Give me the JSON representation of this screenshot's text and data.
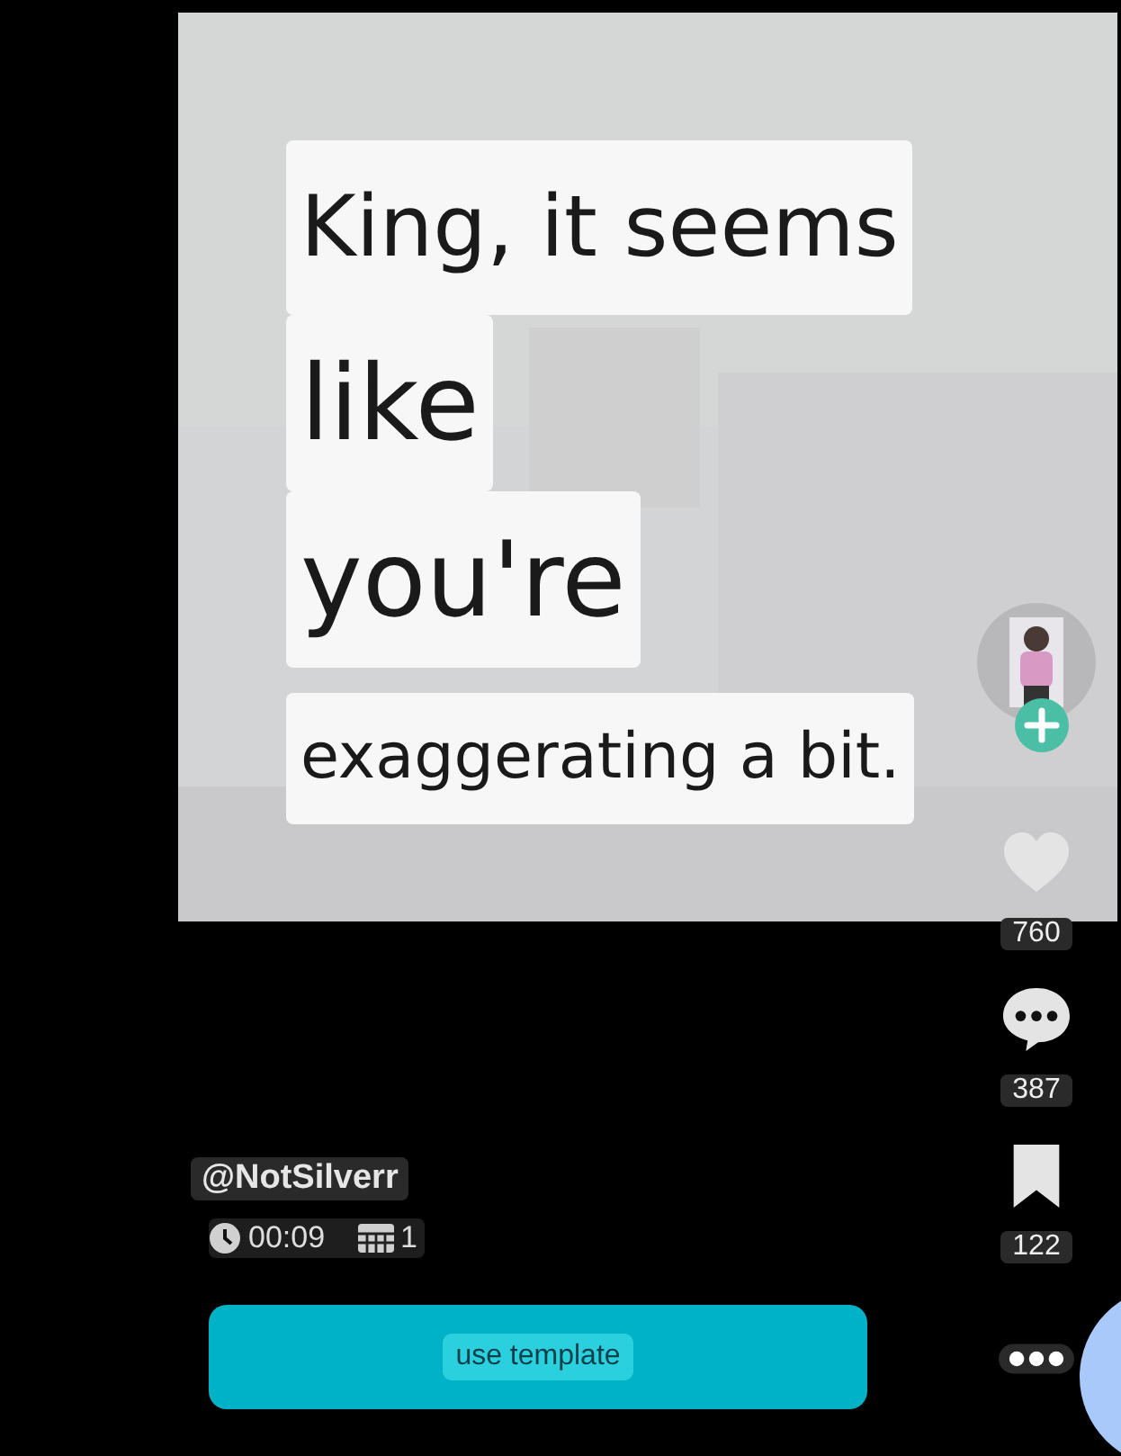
{
  "captions": [
    {
      "text": "King, it seems",
      "kind": "medium"
    },
    {
      "text": "like",
      "kind": "large"
    },
    {
      "text": "you're",
      "kind": "large"
    },
    {
      "text": "exaggerating a bit.",
      "kind": "small"
    }
  ],
  "actions": [
    {
      "kind": "like",
      "count": "760"
    },
    {
      "kind": "comment",
      "count": "387"
    },
    {
      "kind": "save",
      "count": "122"
    },
    {
      "kind": "more"
    }
  ],
  "author": "@NotSilverr",
  "duration": "00:09",
  "clips": "1",
  "button": "use template"
}
